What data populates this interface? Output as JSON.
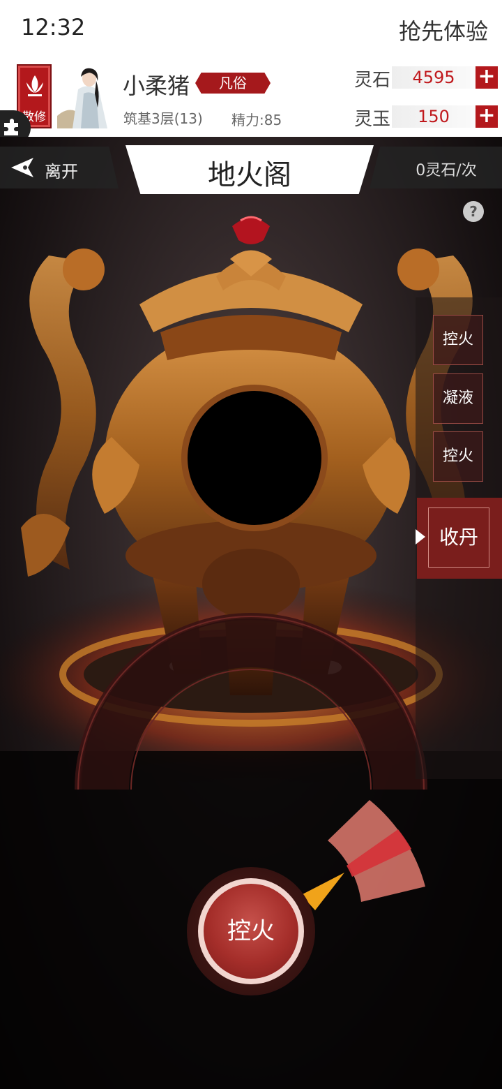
{
  "status_bar": {
    "time": "12:32",
    "action": "抢先体验"
  },
  "player": {
    "sect_label": "散修",
    "name": "小柔猪",
    "rank": "凡俗",
    "realm": "筑基3层(13)",
    "energy": "精力:85"
  },
  "currency": [
    {
      "label": "灵石",
      "value": "4595",
      "plus": "+"
    },
    {
      "label": "灵玉",
      "value": "150",
      "plus": "+"
    }
  ],
  "nav": {
    "leave_label": "离开",
    "title": "地火阁",
    "cost": "0灵石/次",
    "help": "?"
  },
  "steps": [
    {
      "label": "控火"
    },
    {
      "label": "凝液"
    },
    {
      "label": "控火"
    },
    {
      "label": "收丹",
      "active": true
    }
  ],
  "control": {
    "button_label": "控火",
    "gauge_needle_fraction": 0.78,
    "target_zone": [
      0.7,
      0.9
    ]
  },
  "colors": {
    "accent_red": "#b3181c",
    "bronze": "#b8742a",
    "gauge_zone": "#e07a6e"
  },
  "icons": [
    "lotus-sect-icon",
    "leave-arrow-icon",
    "plus-icon",
    "help-icon",
    "puzzle-icon",
    "gauge-needle-icon"
  ]
}
